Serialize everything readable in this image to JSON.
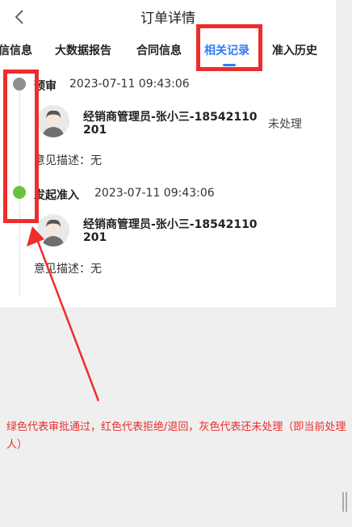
{
  "header": {
    "title": "订单详情"
  },
  "tabs": [
    {
      "label": "信信息"
    },
    {
      "label": "大数据报告"
    },
    {
      "label": "合同信息"
    },
    {
      "label": "相关记录"
    },
    {
      "label": "准入历史"
    }
  ],
  "timeline": [
    {
      "title": "预审",
      "time": "2023-07-11 09:43:06",
      "person": "经销商管理员-张小三-18542110201",
      "status": "未处理",
      "opinion": "意见描述：无",
      "color": "#8f8f8f"
    },
    {
      "title": "发起准入",
      "time": "2023-07-11 09:43:06",
      "person": "经销商管理员-张小三-18542110201",
      "status": "",
      "opinion": "意见描述：无",
      "color": "#6cc040"
    }
  ],
  "annotation": {
    "text": "绿色代表审批通过，红色代表拒绝/退回，灰色代表还未处理（即当前处理人）",
    "color": "#ee2c2c"
  },
  "colors": {
    "accent": "#2f7cf6",
    "approved": "#6cc040",
    "pending": "#8f8f8f",
    "rejected": "#ee2c2c"
  }
}
